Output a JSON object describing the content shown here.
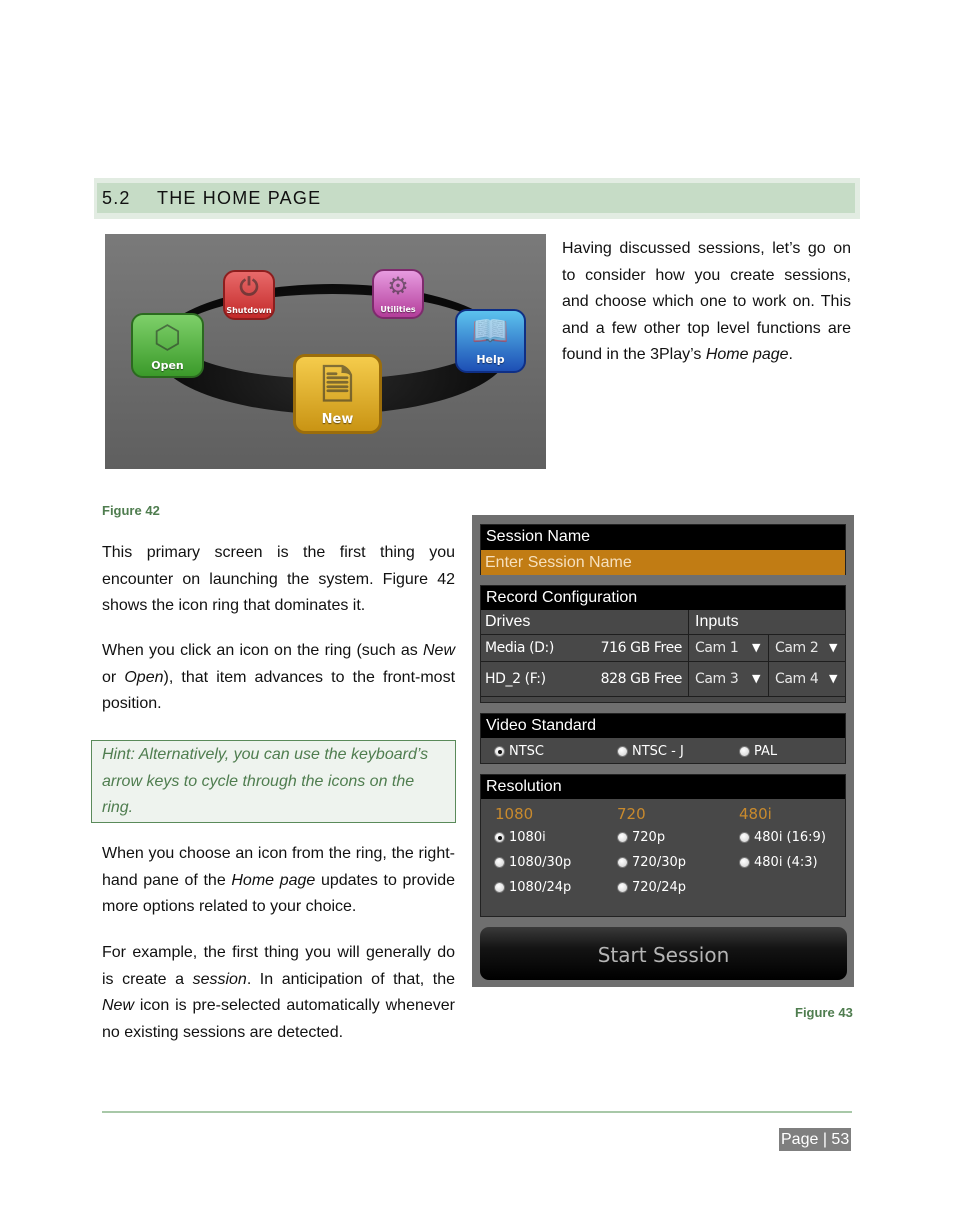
{
  "section": {
    "number": "5.2",
    "title": "THE HOME PAGE"
  },
  "intro": {
    "text_before": "Having discussed sessions, let’s go on to consider how you create sessions, and choose which one to work on. This and a few other top level functions are found in the 3Play’s ",
    "text_italic": "Home page",
    "text_after": "."
  },
  "figure42": {
    "caption": "Figure 42",
    "icons": [
      {
        "name": "Shutdown",
        "icon": "power-icon",
        "color": "#c42a2a"
      },
      {
        "name": "Utilities",
        "icon": "gears-icon",
        "color": "#b33d9a"
      },
      {
        "name": "Open",
        "icon": "box-icon",
        "color": "#3b9a2a"
      },
      {
        "name": "Help",
        "icon": "book-icon",
        "color": "#1d4fb5"
      },
      {
        "name": "New",
        "icon": "new-document-icon",
        "color": "#c99414"
      }
    ]
  },
  "paragraphs": {
    "p1": "This primary screen is the first thing you encounter on launching the system.  Figure 42 shows the icon ring that dominates it.",
    "p2_a": "When you click an icon on the ring (such as ",
    "p2_new": "New",
    "p2_b": " or ",
    "p2_open": "Open",
    "p2_c": "), that item advances to the front-most position.",
    "hint": "Hint: Alternatively, you can use the keyboard’s arrow keys to cycle through the icons on the ring.",
    "p3_a": "When you choose an icon from the ring, the right-hand pane of the ",
    "p3_i": "Home page",
    "p3_b": " updates to provide more options related to your choice.",
    "p4_a": "For example, the first thing you will generally do is create a ",
    "p4_i1": "session",
    "p4_b": ". In anticipation of that, the ",
    "p4_i2": "New",
    "p4_c": " icon is pre-selected automatically whenever no existing sessions are detected."
  },
  "figure43": {
    "caption": "Figure 43",
    "session_name": {
      "header": "Session Name",
      "placeholder": "Enter Session Name"
    },
    "record_config": {
      "header": "Record Configuration",
      "drives_header": "Drives",
      "inputs_header": "Inputs",
      "rows": [
        {
          "drive": "Media (D:)",
          "free": "716 GB Free",
          "input_a": "Cam 1",
          "input_b": "Cam 2"
        },
        {
          "drive": "HD_2 (F:)",
          "free": "828 GB Free",
          "input_a": "Cam 3",
          "input_b": "Cam 4"
        }
      ]
    },
    "video_standard": {
      "header": "Video Standard",
      "options": [
        "NTSC",
        "NTSC - J",
        "PAL"
      ],
      "selected": "NTSC"
    },
    "resolution": {
      "header": "Resolution",
      "groups": [
        {
          "label": "1080",
          "options": [
            "1080i",
            "1080/30p",
            "1080/24p"
          ]
        },
        {
          "label": "720",
          "options": [
            "720p",
            "720/30p",
            "720/24p"
          ]
        },
        {
          "label": "480i",
          "options": [
            "480i (16:9)",
            "480i (4:3)"
          ]
        }
      ],
      "selected": "1080i"
    },
    "start_button": "Start Session"
  },
  "footer": {
    "page_label": "Page | 53"
  }
}
